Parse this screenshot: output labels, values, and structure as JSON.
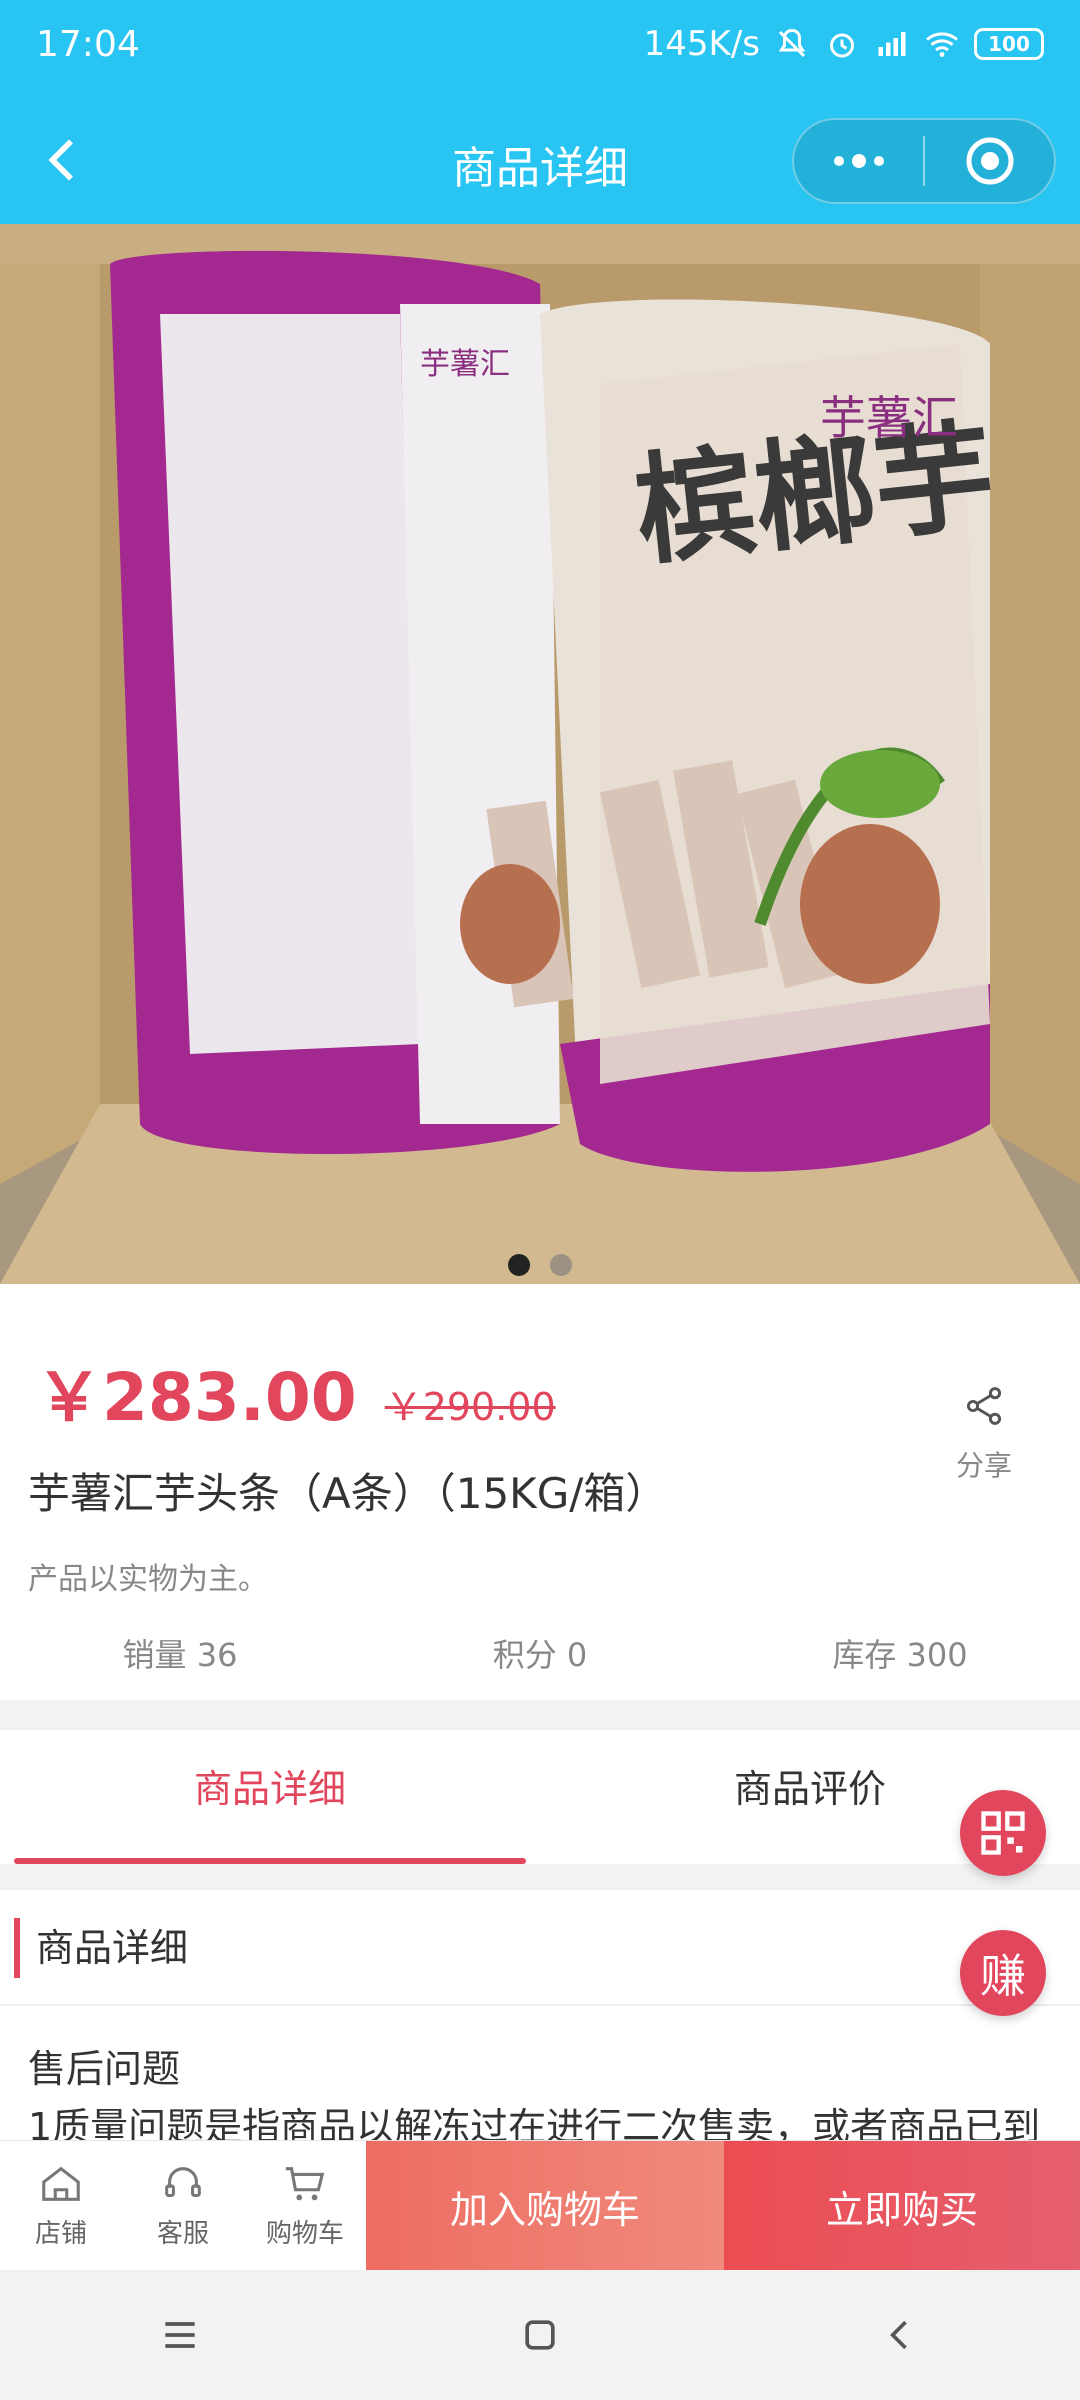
{
  "status_bar": {
    "time": "17:04",
    "net_speed": "145K/s",
    "battery": "100"
  },
  "header": {
    "title": "商品详细",
    "icons": [
      "back-icon",
      "more-icon",
      "record-icon"
    ]
  },
  "carousel": {
    "image_count": 2,
    "active_index": 0
  },
  "product": {
    "price": "￥283.00",
    "original_price": "￥290.00",
    "name": "芋薯汇芋头条（A条）（15KG/箱）",
    "description": "产品以实物为主。",
    "share_label": "分享",
    "stats": {
      "sales": "销量 36",
      "points": "积分 0",
      "stock": "库存 300"
    }
  },
  "tabs": [
    {
      "label": "商品详细",
      "active": true
    },
    {
      "label": "商品评价",
      "active": false
    }
  ],
  "detail": {
    "heading": "商品详细",
    "subheading": "售后问题",
    "text": "1质量问题是指商品以解冻过在进行二次售卖，或者商品已到"
  },
  "floating": {
    "qr_icon": "qr-code-icon",
    "earn_label": "赚"
  },
  "bottom_bar": {
    "shop_label": "店铺",
    "service_label": "客服",
    "cart_label": "购物车",
    "add_cart_label": "加入购物车",
    "buy_label": "立即购买"
  },
  "colors": {
    "header": "#28c4f2",
    "accent": "#e2465c"
  }
}
